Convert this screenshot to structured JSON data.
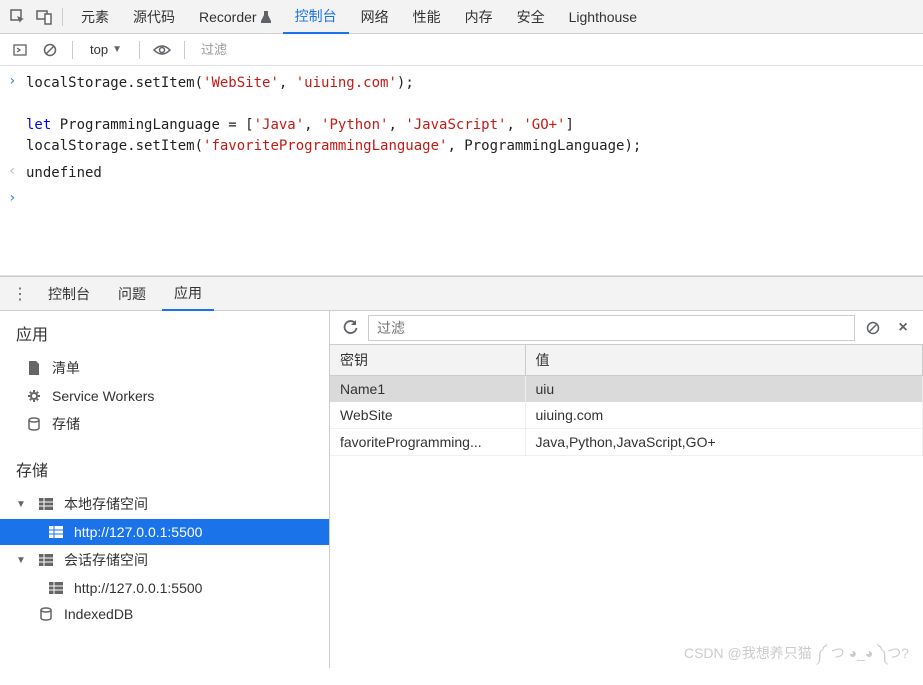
{
  "main_tabs": [
    "元素",
    "源代码",
    "Recorder",
    "控制台",
    "网络",
    "性能",
    "内存",
    "安全",
    "Lighthouse"
  ],
  "main_active_tab": "控制台",
  "console_toolbar": {
    "scope": "top",
    "filter_placeholder": "过滤"
  },
  "code": {
    "line1_a": "localStorage.setItem(",
    "line1_s1": "'WebSite'",
    "line1_b": ", ",
    "line1_s2": "'uiuing.com'",
    "line1_c": ");",
    "let_kw": "let",
    "line2_a": " ProgrammingLanguage = [",
    "line2_s1": "'Java'",
    "line2_s2": "'Python'",
    "line2_s3": "'JavaScript'",
    "line2_s4": "'GO+'",
    "line2_e": "]",
    "comma": ", ",
    "line3_a": "localStorage.setItem(",
    "line3_s1": "'favoriteProgrammingLanguage'",
    "line3_b": ", ProgrammingLanguage);",
    "undefined_label": "undefined"
  },
  "drawer_tabs": [
    "控制台",
    "问题",
    "应用"
  ],
  "drawer_active_tab": "应用",
  "sidebar": {
    "app_section": "应用",
    "app_items": [
      "清单",
      "Service Workers",
      "存储"
    ],
    "storage_section": "存储",
    "local_storage": "本地存储空间",
    "local_origin": "http://127.0.0.1:5500",
    "session_storage": "会话存储空间",
    "session_origin": "http://127.0.0.1:5500",
    "indexeddb": "IndexedDB"
  },
  "storage_panel": {
    "filter_placeholder": "过滤",
    "headers": [
      "密钥",
      "值"
    ],
    "rows": [
      {
        "k": "Name1",
        "v": "uiu"
      },
      {
        "k": "WebSite",
        "v": "uiuing.com"
      },
      {
        "k": "favoriteProgramming...",
        "v": "Java,Python,JavaScript,GO+"
      }
    ]
  },
  "watermark": "CSDN @我想养只猫 ༼ つ ◕_◕ ༽つ?"
}
